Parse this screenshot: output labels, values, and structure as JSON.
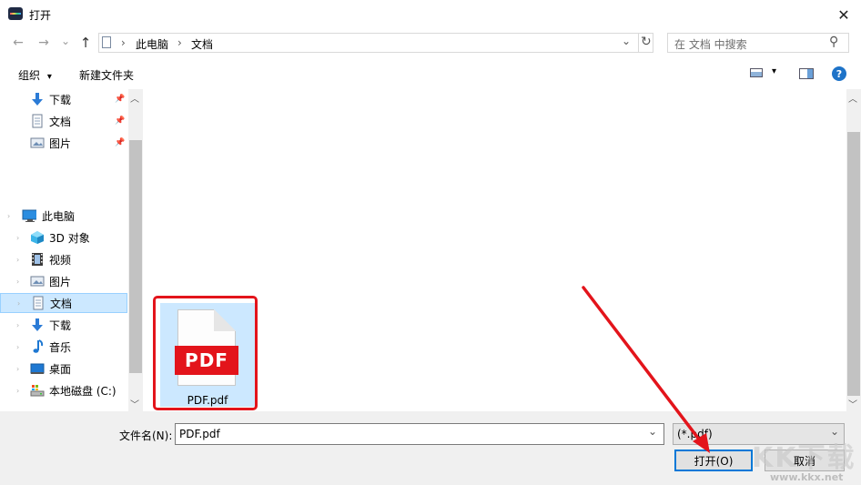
{
  "window": {
    "title": "打开",
    "close_glyph": "✕"
  },
  "nav": {
    "back_glyph": "←",
    "forward_glyph": "→",
    "dropdown_glyph": "⌄",
    "up_glyph": "↑",
    "breadcrumb": [
      "此电脑",
      "文档"
    ],
    "separator": "›",
    "refresh_glyph": "↻",
    "search_placeholder": "在 文档 中搜索",
    "search_glyph": "⚲"
  },
  "toolbar": {
    "organize_label": "组织",
    "organize_caret": "▾",
    "new_folder_label": "新建文件夹",
    "view_caret": "▾",
    "help_glyph": "?"
  },
  "sidebar": {
    "quick_access": [
      {
        "label": "下载",
        "icon": "download-icon"
      },
      {
        "label": "文档",
        "icon": "document-icon"
      },
      {
        "label": "图片",
        "icon": "pictures-icon"
      }
    ],
    "pin_glyph": "📌",
    "this_pc": {
      "label": "此电脑",
      "icon": "computer-icon"
    },
    "pc_items": [
      {
        "label": "3D 对象",
        "icon": "3d-objects-icon"
      },
      {
        "label": "视频",
        "icon": "video-icon"
      },
      {
        "label": "图片",
        "icon": "pictures-icon"
      },
      {
        "label": "文档",
        "icon": "document-icon",
        "selected": true
      },
      {
        "label": "下载",
        "icon": "download-icon"
      },
      {
        "label": "音乐",
        "icon": "music-icon"
      },
      {
        "label": "桌面",
        "icon": "desktop-icon"
      },
      {
        "label": "本地磁盘 (C:)",
        "icon": "drive-icon"
      }
    ],
    "scroll_up": "︿",
    "scroll_down": "﹀"
  },
  "content": {
    "files": [
      {
        "name": "PDF.pdf",
        "badge": "PDF",
        "selected": true
      }
    ],
    "scroll_up": "︿",
    "scroll_down": "﹀"
  },
  "bottom": {
    "filename_label": "文件名(N):",
    "filename_value": "PDF.pdf",
    "filetype_value": "(*.pdf)",
    "dropdown_glyph": "⌄",
    "open_label": "打开(O)",
    "cancel_label": "取消"
  },
  "watermark": {
    "text": "KK下载",
    "url": "www.kkx.net"
  },
  "colors": {
    "selection": "#cce8ff",
    "highlight_frame": "#e3141b",
    "arrow": "#e3141b",
    "accent": "#0078d7"
  }
}
